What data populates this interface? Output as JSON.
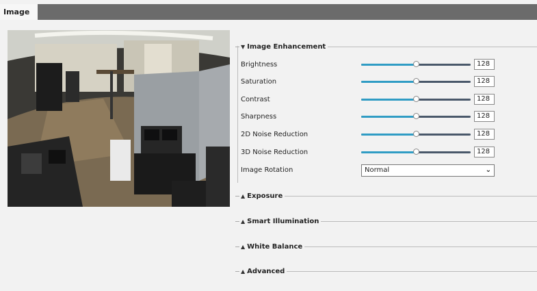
{
  "tab": {
    "label": "Image"
  },
  "enhancement": {
    "title": "Image Enhancement",
    "rows": [
      {
        "label": "Brightness",
        "value": "128",
        "level": 0.5
      },
      {
        "label": "Saturation",
        "value": "128",
        "level": 0.5
      },
      {
        "label": "Contrast",
        "value": "128",
        "level": 0.5
      },
      {
        "label": "Sharpness",
        "value": "128",
        "level": 0.5
      },
      {
        "label": "2D Noise Reduction",
        "value": "128",
        "level": 0.5
      },
      {
        "label": "3D Noise Reduction",
        "value": "128",
        "level": 0.5
      }
    ],
    "rotation": {
      "label": "Image Rotation",
      "value": "Normal"
    }
  },
  "sections": {
    "exposure": "Exposure",
    "smart_illumination": "Smart Illumination",
    "white_balance": "White Balance",
    "advanced": "Advanced"
  },
  "colors": {
    "slider_fill": "#2f9cc4",
    "slider_track": "#49586a",
    "tabbar": "#6b6b6b"
  }
}
